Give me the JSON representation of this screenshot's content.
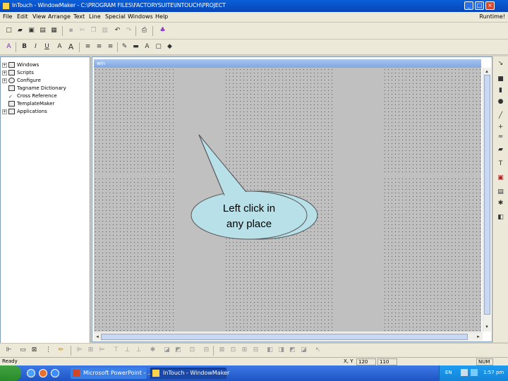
{
  "window": {
    "title": "InTouch - WindowMaker - C:\\PROGRAM FILES\\FACTORYSUITE\\INTOUCH\\PROJECT",
    "min_glyph": "_",
    "max_glyph": "□",
    "close_glyph": "×"
  },
  "menu": {
    "items": [
      "File",
      "Edit",
      "View",
      "Arrange",
      "Text",
      "Line",
      "Special",
      "Windows",
      "Help"
    ],
    "runtime_label": "Runtime!"
  },
  "toolbar": {
    "bold": "B",
    "italic": "I",
    "underline": "U"
  },
  "tree": {
    "items": [
      "Windows",
      "Scripts",
      "Configure",
      "Tagname Dictionary",
      "Cross Reference",
      "TemplateMaker",
      "Applications"
    ]
  },
  "document": {
    "title": "win"
  },
  "callout": {
    "line1": "Left click in",
    "line2": "any place"
  },
  "statusbar": {
    "status": "Ready",
    "xy_label": "X, Y",
    "x_value": "120",
    "y_value": "110",
    "num": "NUM"
  },
  "taskbar": {
    "apps": [
      "Microsoft PowerPoint - ...",
      "InTouch - WindowMaker"
    ],
    "lang": "EN",
    "clock": "1:57 pm"
  },
  "colors": {
    "titlebar": "#0846b8",
    "canvas": "#c0c0c0",
    "callout_fill": "#b8e0e8",
    "taskbar": "#1f55c4"
  }
}
